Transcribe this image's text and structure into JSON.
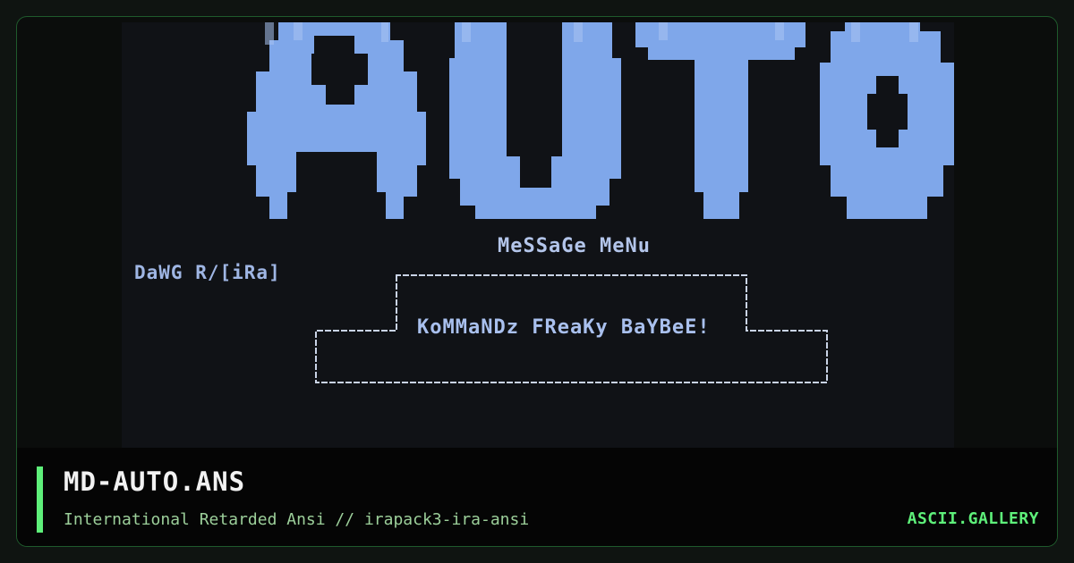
{
  "art": {
    "logo_text": "AUTO",
    "menu_title": "MeSSaGe MeNu",
    "author_tag": "DaWG R/[iRa]",
    "box_text": "KoMMaNDz FReaKy BaYBeE!"
  },
  "footer": {
    "title": "MD-AUTO.ANS",
    "subtitle": "International Retarded Ansi // irapack3-ira-ansi",
    "site": "ASCII.GALLERY"
  },
  "colors": {
    "ansi_blue": "#7fa7ea",
    "accent_green": "#5ef07a",
    "card_border": "#1f5a2c"
  }
}
